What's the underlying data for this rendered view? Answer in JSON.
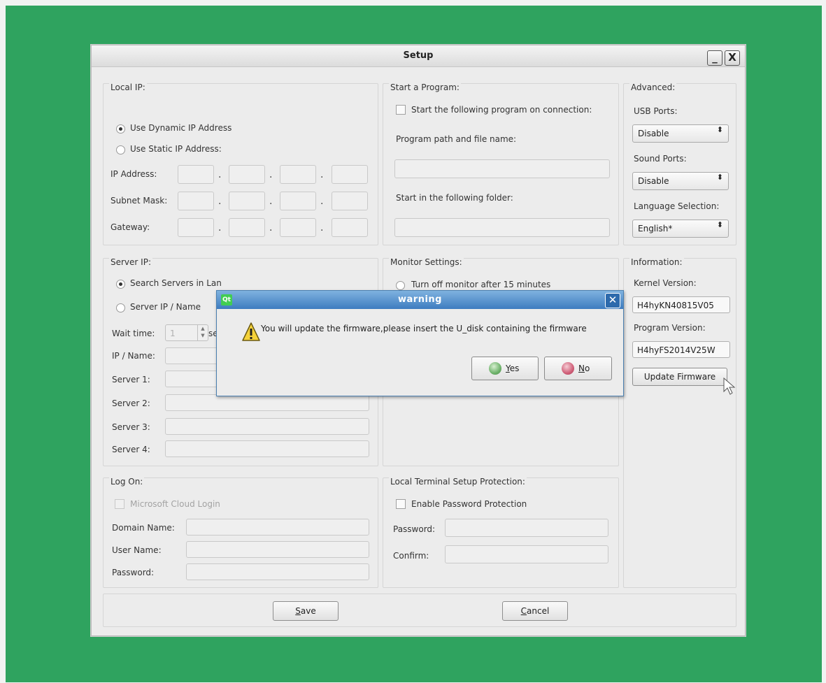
{
  "window": {
    "title": "Setup",
    "minimize": "_",
    "close": "X"
  },
  "local_ip": {
    "title": "Local IP:",
    "dynamic_label": "Use Dynamic IP Address",
    "static_label": "Use Static IP Address:",
    "ip_label": "IP Address:",
    "subnet_label": "Subnet Mask:",
    "gateway_label": "Gateway:",
    "dot": "."
  },
  "start_program": {
    "title": "Start a Program:",
    "checkbox_label": "Start the following program on connection:",
    "path_label": "Program path and file name:",
    "folder_label": "Start in the following folder:"
  },
  "advanced": {
    "title": "Advanced:",
    "usb_label": "USB Ports:",
    "usb_value": "Disable",
    "sound_label": "Sound Ports:",
    "sound_value": "Disable",
    "lang_label": "Language Selection:",
    "lang_value": "English*",
    "combo_arrow": "⬍"
  },
  "server_ip": {
    "title": "Server IP:",
    "search_label": "Search Servers in Lan",
    "server_name_label": "Server IP / Name",
    "wait_label": "Wait time:",
    "wait_value": "1",
    "wait_unit": "se",
    "ip_name_label": "IP / Name:",
    "server1": "Server 1:",
    "server2": "Server 2:",
    "server3": "Server 3:",
    "server4": "Server 4:"
  },
  "monitor": {
    "title": "Monitor Settings:",
    "turnoff_label": "Turn off monitor after 15 minutes"
  },
  "information": {
    "title": "Information:",
    "kernel_label": "Kernel Version:",
    "kernel_value": "H4hyKN40815V05",
    "program_label": "Program Version:",
    "program_value": "H4hyFS2014V25W",
    "update_button": "Update Firmware"
  },
  "log_on": {
    "title": "Log On:",
    "cloud_label": "Microsoft Cloud Login",
    "domain_label": "Domain Name:",
    "user_label": "User Name:",
    "password_label": "Password:"
  },
  "protection": {
    "title": "Local Terminal Setup Protection:",
    "enable_label": "Enable Password Protection",
    "password_label": "Password:",
    "confirm_label": "Confirm:"
  },
  "buttons": {
    "save_u": "S",
    "save_rest": "ave",
    "cancel_u": "C",
    "cancel_rest": "ancel"
  },
  "dialog": {
    "app_badge": "Qt",
    "title": "warning",
    "close": "✕",
    "message": "You will update the firmware,please insert the U_disk containing the firmware",
    "yes_u": "Y",
    "yes_rest": "es",
    "no_u": "N",
    "no_rest": "o"
  },
  "colors": {
    "screen_bg": "#2fa35f",
    "dialog_titlebar": "#3d7cc0",
    "window_bg": "#ececec"
  }
}
